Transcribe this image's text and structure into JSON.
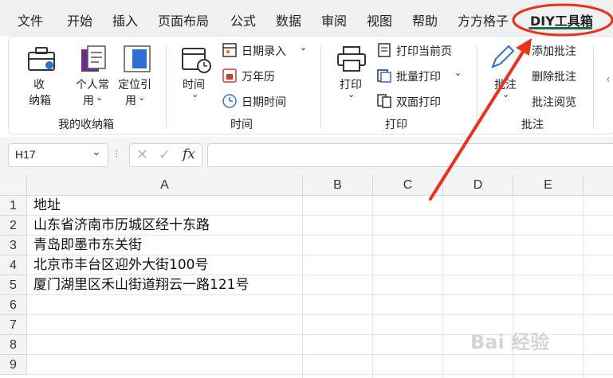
{
  "menu": {
    "items": [
      "文件",
      "开始",
      "插入",
      "页面布局",
      "公式",
      "数据",
      "审阅",
      "视图",
      "帮助",
      "方方格子",
      "DIY工具箱"
    ],
    "active_index": 10
  },
  "ribbon": {
    "groups": {
      "shoucang": {
        "label": "我的收纳箱",
        "box_label": [
          "收",
          "纳箱"
        ],
        "personal_label": [
          "个人常",
          "用"
        ],
        "locate_label": [
          "定位引",
          "用"
        ]
      },
      "time": {
        "label": "时间",
        "time_button": "时间",
        "date_entry": "日期录入",
        "calendar": "万年历",
        "datetime": "日期时间"
      },
      "print": {
        "label": "打印",
        "print_button": "打印",
        "print_current": "打印当前页",
        "batch_print": "批量打印",
        "duplex_print": "双面打印"
      },
      "comment": {
        "label": "批注",
        "comment_button": "批注",
        "add_comment": "添加批注",
        "delete_comment": "删除批注",
        "read_comment": "批注阅览"
      }
    }
  },
  "formula_bar": {
    "cell_ref": "H17",
    "fx": "fx",
    "formula": ""
  },
  "sheet": {
    "columns": [
      "A",
      "B",
      "C",
      "D",
      "E"
    ],
    "rows": [
      "1",
      "2",
      "3",
      "4",
      "5",
      "6",
      "7",
      "8",
      "9"
    ],
    "cells": [
      "地址",
      "山东省济南市历城区经十东路",
      "青岛即墨市东关街",
      "北京市丰台区迎外大街100号",
      "厦门湖里区禾山街道翔云一路121号"
    ]
  },
  "annotation": {
    "color": "#e8321c",
    "target": "DIY工具箱"
  },
  "watermark": "Bai 经验"
}
